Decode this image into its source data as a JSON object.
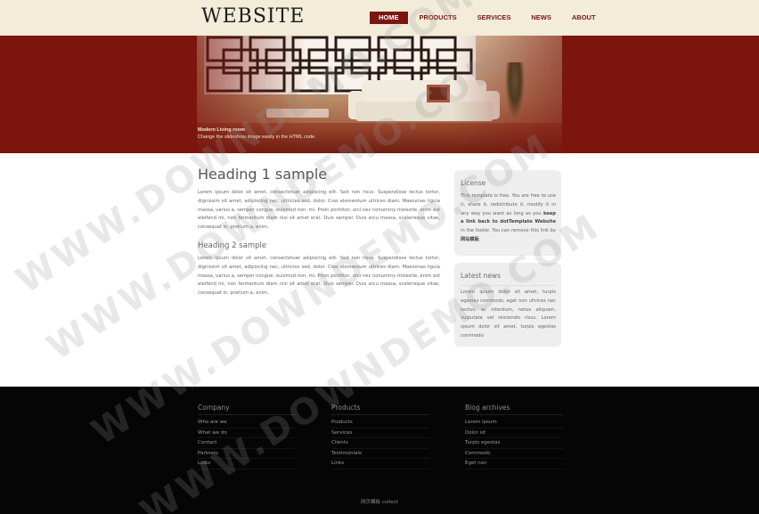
{
  "header": {
    "logo": "WEBSITE",
    "nav": [
      {
        "label": "HOME",
        "active": true
      },
      {
        "label": "PRODUCTS",
        "active": false
      },
      {
        "label": "SERVICES",
        "active": false
      },
      {
        "label": "NEWS",
        "active": false
      },
      {
        "label": "ABOUT",
        "active": false
      }
    ]
  },
  "banner": {
    "caption_title": "Modern Living room",
    "caption_text": "Change the slideshow image easily in the HTML code."
  },
  "main": {
    "heading1": "Heading 1 sample",
    "paragraph1": "Lorem ipsum dolor sit amet, consectetuer adipiscing elit. Sed non risus. Suspendisse lectus tortor, dignissim sit amet, adipiscing nec, ultricies sed, dolor. Cras elementum ultrices diam. Maecenas ligula massa, varius a, semper congue, euismod non, mi. Proin porttitor, orci nec nonummy molestie, enim est eleifend mi, non fermentum diam nisl sit amet erat. Duis semper. Duis arcu massa, scelerisque vitae, consequat in, pretium a, enim.",
    "heading2": "Heading 2 sample",
    "paragraph2": "Lorem ipsum dolor sit amet, consectetuer adipiscing elit. Sed non risus. Suspendisse lectus tortor, dignissim sit amet, adipiscing nec, ultricies sed, dolor. Cras elementum ultrices diam. Maecenas ligula massa, varius a, semper congue, euismod non, mi. Proin porttitor, orci nec nonummy molestie, enim est eleifend mi, non fermentum diam nisl sit amet erat. Duis semper. Duis arcu massa, scelerisque vitae, consequat in, pretium a, enim."
  },
  "sidebar": {
    "license_title": "License",
    "license_text_1": "This template is free. You are free to use it, share it, redistribute it, modify it in any way you want as long as you ",
    "license_bold_1": "keep a link back to dotTemplate Website",
    "license_text_2": " in the footer. You can remove this link by ",
    "license_bold_2": "网站模板",
    "license_text_3": ".",
    "news_title": "Latest news",
    "news_text": "Lorem ipsum dolor sit amet, turpis egestas commodo, eget non ultrices nec tectus, ac interdum, netus aliquam, vulputate vel reiciendis risus. Lorem ipsum dolor sit amet, turpis egestas commodo"
  },
  "footer": {
    "columns": [
      {
        "title": "Company",
        "links": [
          "Who are we",
          "What we do",
          "Contact",
          "Partners",
          "Links"
        ]
      },
      {
        "title": "Products",
        "links": [
          "Products",
          "Services",
          "Clients",
          "Testimonials",
          "Links"
        ]
      },
      {
        "title": "Blog archives",
        "links": [
          "Lorem ipsum",
          "Dolor sit",
          "Turpis egestas",
          "Commodo",
          "Eget non"
        ]
      }
    ],
    "copyright_link": "网页模板",
    "copyright_text": " collect"
  },
  "watermark": {
    "text": "WWW.DOWNDEMO.COM"
  },
  "colors": {
    "brand_red": "#7a1612",
    "header_bg": "#f2ecd9",
    "footer_bg": "#050505",
    "box_bg": "#eeeeee"
  }
}
